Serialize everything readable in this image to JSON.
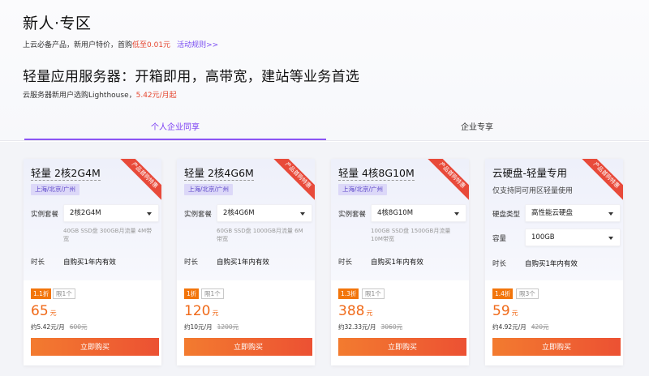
{
  "header": {
    "title": "新人·专区",
    "subline_prefix": "上云必备产品，新用户特价，首购",
    "subline_highlight": "低至0.01元",
    "rules_link": "活动规则>>",
    "headline": "轻量应用服务器：开箱即用，高带宽，建站等业务首选",
    "subline2_prefix": "云服务器新用户选购Lighthouse，",
    "subline2_highlight": "5.42元/月起"
  },
  "tabs": [
    {
      "label": "个人企业同享",
      "active": true
    },
    {
      "label": "企业专享",
      "active": false
    }
  ],
  "ribbon_text": "产品首购特惠",
  "cards": [
    {
      "name": "轻量 2核2G4M",
      "region": "上海/北京/广州",
      "spec_label": "实例套餐",
      "spec_value": "2核2G4M",
      "spec_note": "40GB SSD盘 300GB月流量 4M带宽",
      "duration_label": "时长",
      "duration_value": "自购买1年内有效",
      "discount": "1.1折",
      "limit": "限1个",
      "price": "65",
      "price_unit": "元",
      "per_month": "约5.42元/月",
      "original": "600元",
      "buy_label": "立即购买"
    },
    {
      "name": "轻量 2核4G6M",
      "region": "上海/北京/广州",
      "spec_label": "实例套餐",
      "spec_value": "2核4G6M",
      "spec_note": "60GB SSD盘 1000GB月流量 6M带宽",
      "duration_label": "时长",
      "duration_value": "自购买1年内有效",
      "discount": "1折",
      "limit": "限1个",
      "price": "120",
      "price_unit": "元",
      "per_month": "约10元/月",
      "original": "1200元",
      "buy_label": "立即购买"
    },
    {
      "name": "轻量 4核8G10M",
      "region": "上海/北京/广州",
      "spec_label": "实例套餐",
      "spec_value": "4核8G10M",
      "spec_note": "100GB SSD盘 1500GB月流量 10M带宽",
      "duration_label": "时长",
      "duration_value": "自购买1年内有效",
      "discount": "1.3折",
      "limit": "限1个",
      "price": "388",
      "price_unit": "元",
      "per_month": "约32.33元/月",
      "original": "3060元",
      "buy_label": "立即购买"
    },
    {
      "name": "云硬盘-轻量专用",
      "sub": "仅支持同可用区轻量使用",
      "disk_type_label": "硬盘类型",
      "disk_type_value": "高性能云硬盘",
      "capacity_label": "容量",
      "capacity_value": "100GB",
      "duration_label": "时长",
      "duration_value": "自购买1年内有效",
      "discount": "1.4折",
      "limit": "限3个",
      "price": "59",
      "price_unit": "元",
      "per_month": "约4.92元/月",
      "original": "420元",
      "buy_label": "立即购买"
    }
  ],
  "colors": {
    "accent_purple": "#8b54f4",
    "price_orange": "#f06a19",
    "button_orange": "#ec5133",
    "discount_orange": "#f2750b",
    "highlight_red": "#e5462f"
  }
}
